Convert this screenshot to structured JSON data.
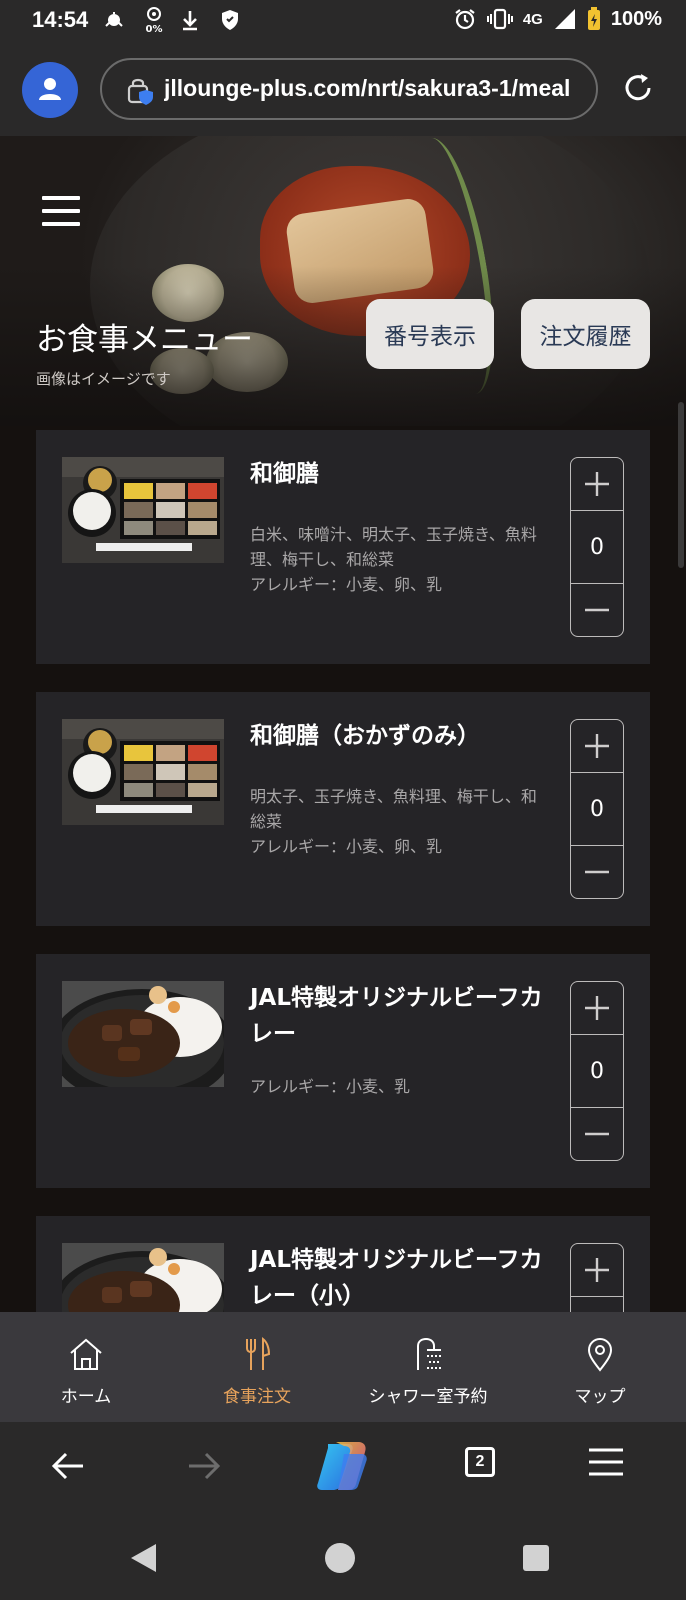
{
  "status_bar": {
    "time": "14:54",
    "data_saver_percent": "0%",
    "network": "4G",
    "battery": "100%",
    "icons": [
      "notification-icon",
      "data-saver-icon",
      "download-icon",
      "shield-icon",
      "alarm-icon",
      "vibrate-icon",
      "signal-icon",
      "battery-icon"
    ]
  },
  "browser": {
    "url": "jllounge-plus.com/nrt/sakura3-1/meal",
    "open_tab_count": "2"
  },
  "header": {
    "title": "お食事メニュー",
    "subtitle": "画像はイメージです",
    "number_display_button": "番号表示",
    "order_history_button": "注文履歴"
  },
  "menu_items": [
    {
      "name": "和御膳",
      "ingredients": "白米、味噌汁、明太子、玉子焼き、魚料理、梅干し、和総菜",
      "allergy": "アレルギー：小麦、卵、乳",
      "quantity": "0"
    },
    {
      "name": "和御膳（おかずのみ）",
      "ingredients": "明太子、玉子焼き、魚料理、梅干し、和総菜",
      "allergy": "アレルギー：小麦、卵、乳",
      "quantity": "0"
    },
    {
      "name": "JAL特製オリジナルビーフカレー",
      "ingredients": "",
      "allergy": "アレルギー：小麦、乳",
      "quantity": "0"
    },
    {
      "name": "JAL特製オリジナルビーフカレー（小）",
      "ingredients": "",
      "allergy": "",
      "quantity": ""
    }
  ],
  "tab_nav": {
    "items": [
      {
        "label": "ホーム",
        "icon": "home-icon"
      },
      {
        "label": "食事注文",
        "icon": "fork-knife-icon",
        "active": true
      },
      {
        "label": "シャワー室予約",
        "icon": "shower-icon"
      },
      {
        "label": "マップ",
        "icon": "map-pin-icon"
      }
    ]
  },
  "colors": {
    "accent": "#e7a35c",
    "card_bg": "#252427",
    "page_bg": "#15110f",
    "avatar": "#3565d6"
  }
}
